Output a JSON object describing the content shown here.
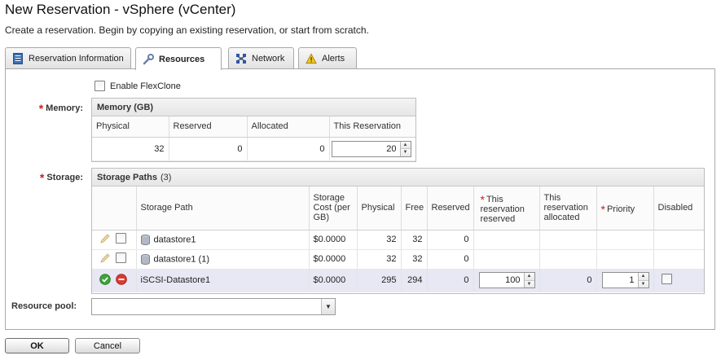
{
  "page": {
    "title": "New Reservation - vSphere (vCenter)",
    "subtitle": "Create a reservation. Begin by copying an existing reservation, or start from scratch."
  },
  "tabs": [
    {
      "label": "Reservation Information",
      "icon": "document-icon"
    },
    {
      "label": "Resources",
      "icon": "wrench-icon",
      "active": true
    },
    {
      "label": "Network",
      "icon": "network-icon"
    },
    {
      "label": "Alerts",
      "icon": "warning-icon"
    }
  ],
  "enable_flexclone": {
    "label": "Enable FlexClone",
    "checked": false
  },
  "memory": {
    "label": "Memory:",
    "header": "Memory (GB)",
    "columns": [
      "Physical",
      "Reserved",
      "Allocated",
      "This Reservation"
    ],
    "physical": "32",
    "reserved": "0",
    "allocated": "0",
    "this_reservation": "20"
  },
  "storage": {
    "label": "Storage:",
    "header": "Storage Paths",
    "count": "(3)",
    "columns": {
      "path": "Storage Path",
      "cost": "Storage Cost (per GB)",
      "physical": "Physical",
      "free": "Free",
      "reserved": "Reserved",
      "this_reserved": "This reservation reserved",
      "this_allocated": "This reservation allocated",
      "priority": "Priority",
      "disabled": "Disabled"
    },
    "rows": [
      {
        "path": "datastore1",
        "cost": "$0.0000",
        "physical": "32",
        "free": "32",
        "reserved": "0"
      },
      {
        "path": "datastore1 (1)",
        "cost": "$0.0000",
        "physical": "32",
        "free": "32",
        "reserved": "0"
      },
      {
        "path": "iSCSI-Datastore1",
        "cost": "$0.0000",
        "physical": "295",
        "free": "294",
        "reserved": "0",
        "this_reserved": "100",
        "this_allocated": "0",
        "priority": "1"
      }
    ]
  },
  "resource_pool": {
    "label": "Resource pool:",
    "value": ""
  },
  "buttons": {
    "ok": "OK",
    "cancel": "Cancel"
  },
  "colors": {
    "required": "#c8201c",
    "selected_row": "#e8e8f4",
    "border": "#a9a9a9"
  }
}
